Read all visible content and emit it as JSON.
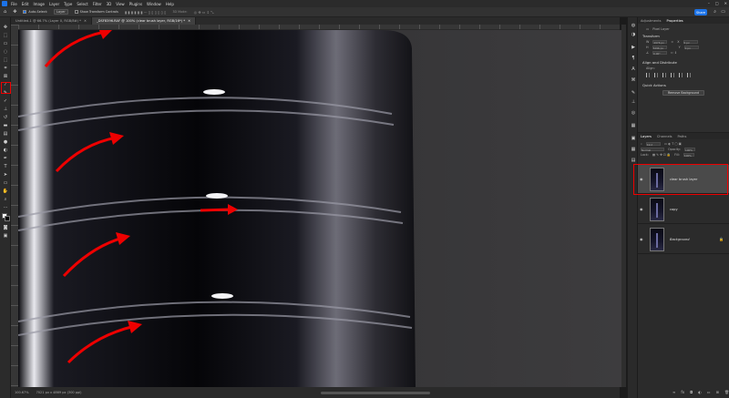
{
  "app": {
    "menu": [
      "File",
      "Edit",
      "Image",
      "Layer",
      "Type",
      "Select",
      "Filter",
      "3D",
      "View",
      "Plugins",
      "Window",
      "Help"
    ],
    "share_label": "Share"
  },
  "options": {
    "auto_select": "Auto-Select:",
    "layer": "Layer",
    "transform": "Show Transform Controls",
    "mode_3d": "3D Mode:"
  },
  "tabs": [
    {
      "label": "Untitled-1 @ 66.7% (Layer 0, RGB/8#) *",
      "active": false
    },
    {
      "label": "_DSF8396.RAF @ 100% (clear brush layer, RGB/16*) *",
      "active": true
    }
  ],
  "status": {
    "zoom": "100.67%",
    "doc": "7021 px x 4869 px (300 ppi)"
  },
  "panel": {
    "tabs": {
      "adjustments": "Adjustments",
      "properties": "Properties"
    },
    "pixel_layer": "Pixel Layer",
    "transform_title": "Transform",
    "w_label": "W",
    "w_value": "4976 px",
    "h_label": "H",
    "h_value": "3296 px",
    "x_label": "X",
    "x_value": "0 px",
    "y_label": "Y",
    "y_value": "0 px",
    "angle_value": "0.00°",
    "align_title": "Align and Distribute",
    "align_sub": "Align:",
    "quick_title": "Quick Actions",
    "remove_bg": "Remove Background"
  },
  "layers_panel": {
    "tabs": {
      "layers": "Layers",
      "channels": "Channels",
      "paths": "Paths"
    },
    "kind": "Kind",
    "blend_mode": "Normal",
    "opacity_label": "Opacity:",
    "opacity_value": "100%",
    "lock_label": "Lock:",
    "fill_label": "Fill:",
    "fill_value": "100%",
    "layers": [
      {
        "name": "clear brush layer",
        "selected": true,
        "locked": false
      },
      {
        "name": "copy",
        "selected": false,
        "locked": false
      },
      {
        "name": "Background",
        "selected": false,
        "locked": true
      }
    ]
  },
  "colors": {
    "accent": "#1c73e8",
    "annotation": "#e00000"
  }
}
